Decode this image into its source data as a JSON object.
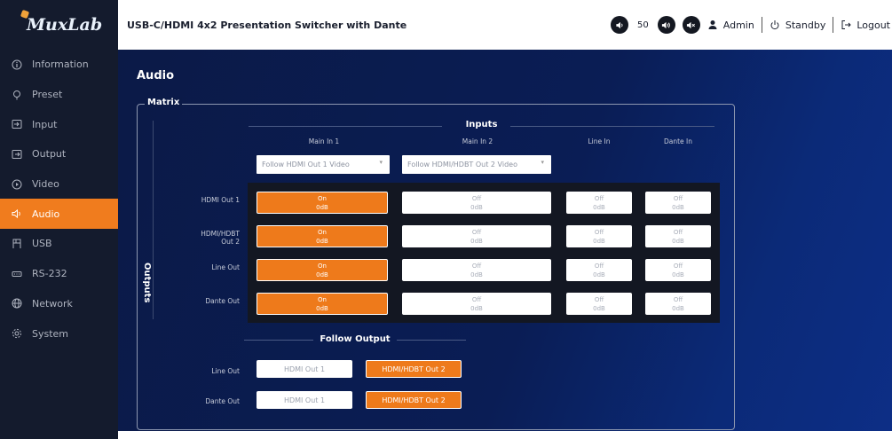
{
  "brand": {
    "logo": "MuxLab"
  },
  "sidebar": {
    "items": [
      {
        "label": "Information",
        "icon": "info-icon"
      },
      {
        "label": "Preset",
        "icon": "preset-icon"
      },
      {
        "label": "Input",
        "icon": "input-icon"
      },
      {
        "label": "Output",
        "icon": "output-icon"
      },
      {
        "label": "Video",
        "icon": "video-icon"
      },
      {
        "label": "Audio",
        "icon": "audio-icon",
        "active": true
      },
      {
        "label": "USB",
        "icon": "usb-icon"
      },
      {
        "label": "RS-232",
        "icon": "rs232-icon"
      },
      {
        "label": "Network",
        "icon": "network-icon"
      },
      {
        "label": "System",
        "icon": "system-icon"
      }
    ]
  },
  "topbar": {
    "title": "USB-C/HDMI 4x2 Presentation Switcher with Dante",
    "volume": "50",
    "user": "Admin",
    "standby": "Standby",
    "logout": "Logout"
  },
  "page": {
    "title": "Audio"
  },
  "matrix": {
    "legend": "Matrix",
    "inputs_label": "Inputs",
    "outputs_label": "Outputs",
    "columns": [
      "Main In 1",
      "Main In 2",
      "Line In",
      "Dante In"
    ],
    "follow_selects": [
      "Follow HDMI Out 1 Video",
      "Follow HDMI/HDBT Out 2 Video"
    ],
    "rows": [
      {
        "label": "HDMI Out 1",
        "cells": [
          {
            "state": "On",
            "level": "0dB"
          },
          {
            "state": "Off",
            "level": "0dB"
          },
          {
            "state": "Off",
            "level": "0dB"
          },
          {
            "state": "Off",
            "level": "0dB"
          }
        ]
      },
      {
        "label": "HDMI/HDBT Out 2",
        "cells": [
          {
            "state": "On",
            "level": "0dB"
          },
          {
            "state": "Off",
            "level": "0dB"
          },
          {
            "state": "Off",
            "level": "0dB"
          },
          {
            "state": "Off",
            "level": "0dB"
          }
        ]
      },
      {
        "label": "Line Out",
        "cells": [
          {
            "state": "On",
            "level": "0dB"
          },
          {
            "state": "Off",
            "level": "0dB"
          },
          {
            "state": "Off",
            "level": "0dB"
          },
          {
            "state": "Off",
            "level": "0dB"
          }
        ]
      },
      {
        "label": "Dante Out",
        "cells": [
          {
            "state": "On",
            "level": "0dB"
          },
          {
            "state": "Off",
            "level": "0dB"
          },
          {
            "state": "Off",
            "level": "0dB"
          },
          {
            "state": "Off",
            "level": "0dB"
          }
        ]
      }
    ]
  },
  "follow_output": {
    "title": "Follow Output",
    "rows": [
      {
        "label": "Line Out",
        "options": [
          "HDMI Out 1",
          "HDMI/HDBT Out 2"
        ],
        "selected": "HDMI/HDBT Out 2"
      },
      {
        "label": "Dante Out",
        "options": [
          "HDMI Out 1",
          "HDMI/HDBT Out 2"
        ],
        "selected": "HDMI/HDBT Out 2"
      }
    ]
  },
  "colors": {
    "accent": "#ee7a1b",
    "sidebar_bg": "#141b2d",
    "main_bg": "#0b1a47"
  }
}
